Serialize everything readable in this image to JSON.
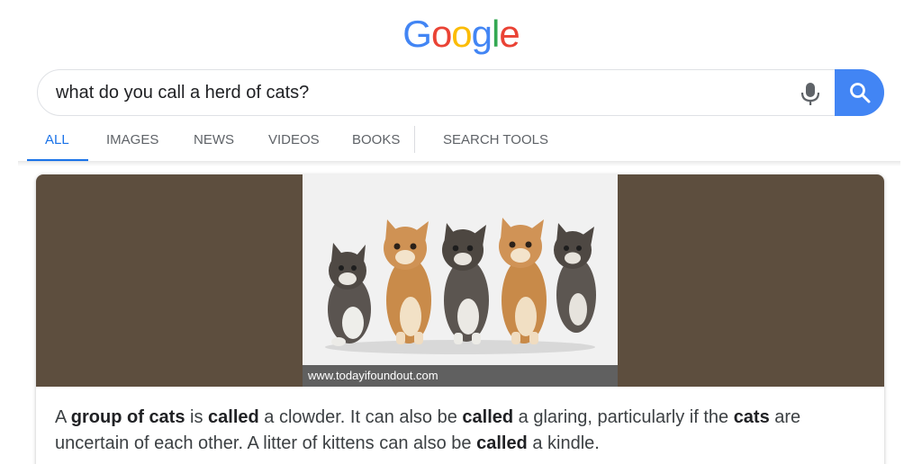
{
  "logo": {
    "letters": [
      "G",
      "o",
      "o",
      "g",
      "l",
      "e"
    ],
    "colors": [
      "#4285f4",
      "#ea4335",
      "#fbbc05",
      "#4285f4",
      "#34a853",
      "#ea4335"
    ]
  },
  "search": {
    "query": "what do you call a herd of cats?",
    "mic_icon": "mic-icon",
    "search_icon": "search-icon",
    "accent": "#4285f4"
  },
  "tabs": [
    {
      "label": "ALL",
      "active": true
    },
    {
      "label": "IMAGES"
    },
    {
      "label": "NEWS"
    },
    {
      "label": "VIDEOS"
    },
    {
      "label": "BOOKS"
    },
    {
      "label": "SEARCH TOOLS"
    }
  ],
  "featured": {
    "image_alt": "five kittens sitting in a row",
    "image_source": "www.todayifoundout.com",
    "snippet": [
      {
        "t": "A "
      },
      {
        "t": "group of cats",
        "b": true
      },
      {
        "t": " is "
      },
      {
        "t": "called",
        "b": true
      },
      {
        "t": " a clowder. It can also be "
      },
      {
        "t": "called",
        "b": true
      },
      {
        "t": " a glaring, particularly if the "
      },
      {
        "t": "cats",
        "b": true
      },
      {
        "t": " are uncertain of each other. A litter of kittens can also be "
      },
      {
        "t": "called",
        "b": true
      },
      {
        "t": " a kindle."
      }
    ]
  }
}
